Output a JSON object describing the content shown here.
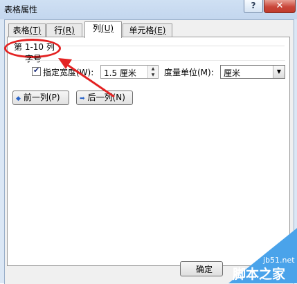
{
  "window": {
    "title": "表格属性",
    "help": "?",
    "close": "✕"
  },
  "tabs": [
    {
      "label": "表格",
      "key": "(T)"
    },
    {
      "label": "行",
      "key": "(R)"
    },
    {
      "label": "列",
      "key": "(U)"
    },
    {
      "label": "单元格",
      "key": "(E)"
    }
  ],
  "column": {
    "section_title": "第 1-10 列",
    "sub_label": "字号",
    "width_checkbox_label": "指定宽度(W):",
    "width_checked": true,
    "width_value": "1.5 厘米",
    "unit_label": "度量单位(M):",
    "unit_value": "厘米"
  },
  "buttons": {
    "prev_column": "前一列(P)",
    "next_column": "后一列(N)",
    "ok": "确定"
  },
  "watermark": {
    "site": "jb51.net",
    "name": "脚本之家"
  },
  "colors": {
    "annotation": "#e32222",
    "accent": "#2a64c8"
  }
}
